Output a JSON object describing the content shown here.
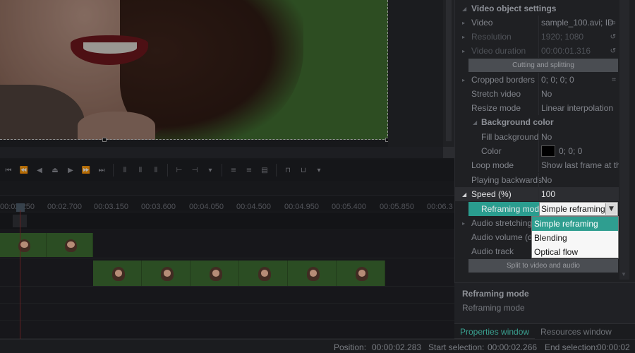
{
  "panel": {
    "section_title": "Video object settings",
    "rows": {
      "video": {
        "label": "Video",
        "value": "sample_100.avi; ID"
      },
      "resolution": {
        "label": "Resolution",
        "value": "1920; 1080"
      },
      "duration": {
        "label": "Video duration",
        "value": "00:00:01.316"
      },
      "cutting_button": "Cutting and splitting",
      "cropped": {
        "label": "Cropped borders",
        "value": "0; 0; 0; 0"
      },
      "stretch": {
        "label": "Stretch video",
        "value": "No"
      },
      "resize": {
        "label": "Resize mode",
        "value": "Linear interpolation"
      },
      "bg_color_section": "Background color",
      "fill_bg": {
        "label": "Fill background",
        "value": "No"
      },
      "color": {
        "label": "Color",
        "value": "0; 0; 0"
      },
      "loop": {
        "label": "Loop mode",
        "value": "Show last frame at th"
      },
      "playing_backwards": {
        "label": "Playing backwards",
        "value": "No"
      },
      "speed": {
        "label": "Speed (%)",
        "value": "100"
      },
      "reframing": {
        "label": "Reframing mod",
        "value": "Simple reframing"
      },
      "audio_stretching": {
        "label": "Audio stretching"
      },
      "audio_volume": {
        "label": "Audio volume (d"
      },
      "audio_track": {
        "label": "Audio track"
      },
      "split_button": "Split to video and audio"
    },
    "dropdown_options": [
      "Simple reframing",
      "Blending",
      "Optical flow"
    ]
  },
  "info": {
    "title": "Reframing mode",
    "description": "Reframing mode"
  },
  "tabs": [
    "Properties window",
    "Resources window"
  ],
  "ruler_ticks": [
    "00:02.250",
    "00:02.700",
    "00:03.150",
    "00:03.600",
    "00:04.050",
    "00:04.500",
    "00:04.950",
    "00:05.400",
    "00:05.850",
    "00:06.3"
  ],
  "status": {
    "position_label": "Position:",
    "position_value": "00:00:02.283",
    "start_label": "Start selection:",
    "start_value": "00:00:02.266",
    "end_label": "End selection:",
    "end_value": "00:00:02"
  },
  "colors": {
    "accent": "#2a9d8f",
    "background": "#1e1f22",
    "green_screen": "#3d6b2c"
  }
}
